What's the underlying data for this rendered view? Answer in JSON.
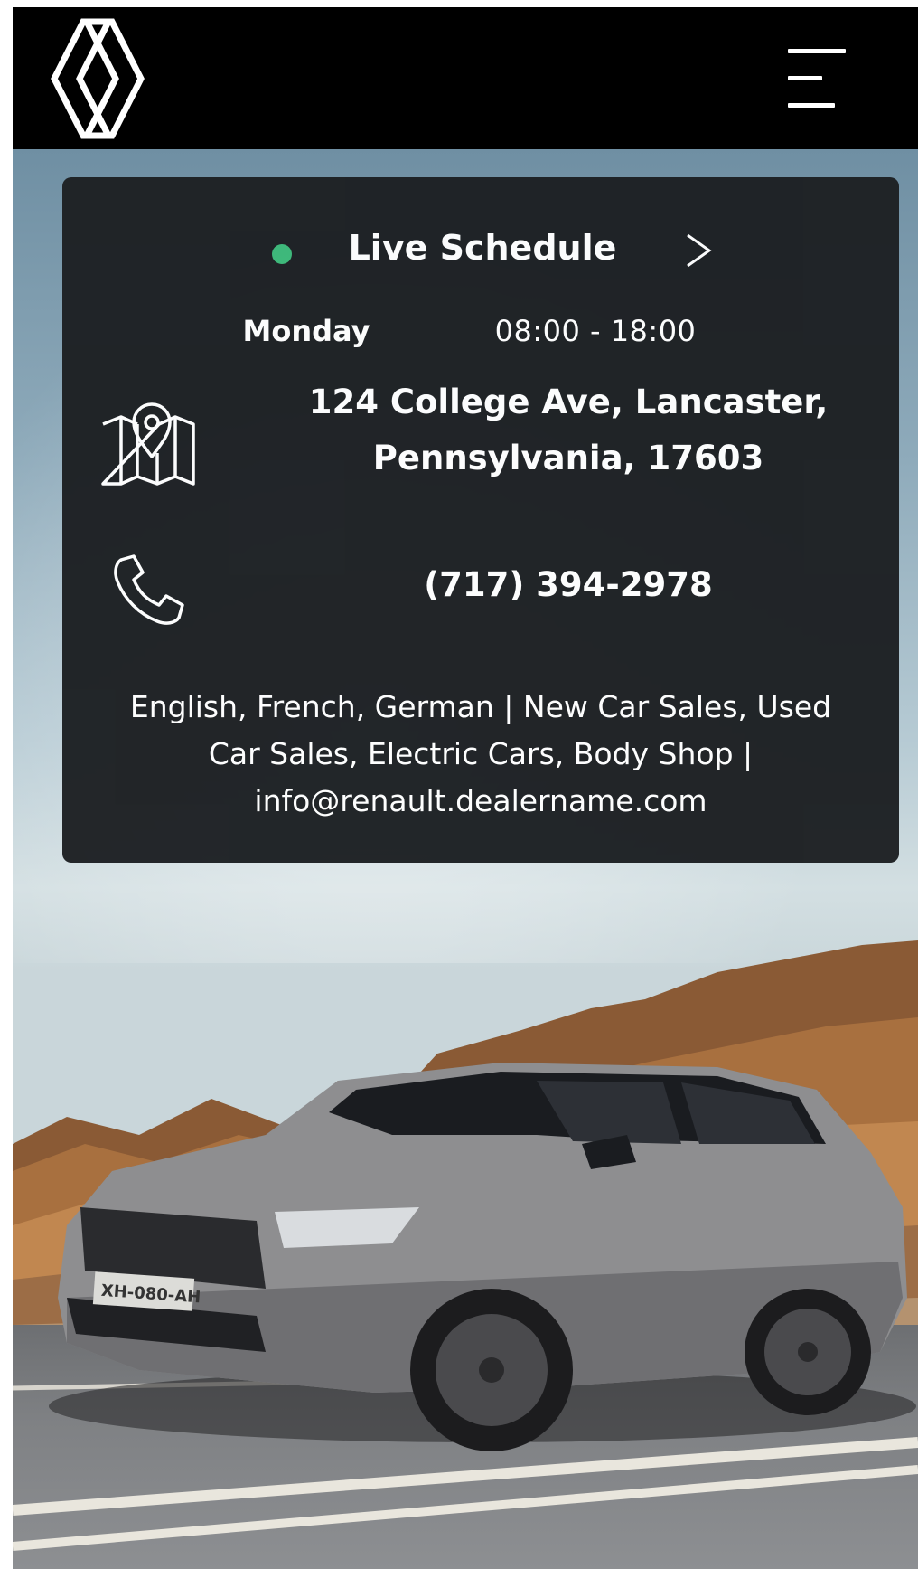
{
  "header": {
    "logo": "renault-diamond-logo",
    "menu_icon": "hamburger-menu-icon",
    "background": "#000000"
  },
  "schedule": {
    "status_color": "#3dba7a",
    "title": "Live Schedule",
    "day": "Monday",
    "hours": "08:00 - 18:00"
  },
  "contact": {
    "address_line1": "124 College Ave, Lancaster,",
    "address_line2": "Pennsylvania, 17603",
    "phone": "(717) 394-2978",
    "info_line1": "English, French, German | New Car Sales, Used",
    "info_line2": "Car Sales, Electric Cars, Body Shop |",
    "email": "info@renault.dealername.com"
  },
  "hero": {
    "plate": "XH-080-AH"
  }
}
